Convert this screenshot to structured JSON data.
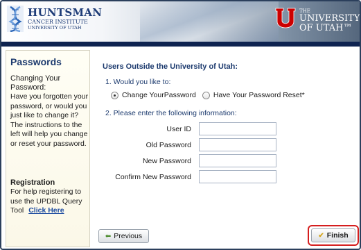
{
  "header": {
    "hci_logo": {
      "line1": "HUNTSMAN",
      "line2": "CANCER INSTITUTE",
      "line3": "UNIVERSITY OF UTAH"
    },
    "uu_logo": {
      "the": "THE",
      "line1": "UNIVERSITY",
      "line2": "OF UTAH™"
    },
    "colors": {
      "band": "#0e2350",
      "uu_red": "#cc0000",
      "hci_blue": "#1f3d78"
    }
  },
  "sidebar": {
    "title": "Passwords",
    "changing_heading": "Changing Your Password:",
    "changing_text": "Have you forgotten your password, or would you just like to change it? The instructions to the left will help you change or reset your password.",
    "registration_heading": "Registration",
    "registration_text": "For help registering to use the UPDBL Query Tool",
    "registration_link": "Click Here"
  },
  "main": {
    "section_title": "Users Outside the University of Utah:",
    "q1": "1. Would you like to:",
    "options": [
      {
        "label": "Change YourPassword",
        "checked": true
      },
      {
        "label": "Have Your Password Reset*",
        "checked": false
      }
    ],
    "q2": "2. Please enter the following information:",
    "fields": [
      {
        "label": "User ID",
        "value": ""
      },
      {
        "label": "Old Password",
        "value": ""
      },
      {
        "label": "New Password",
        "value": ""
      },
      {
        "label": "Confirm New Password",
        "value": ""
      }
    ]
  },
  "buttons": {
    "previous": {
      "label": "Previous",
      "icon": "arrow-left-icon"
    },
    "finish": {
      "label": "Finish",
      "icon": "checkmark-icon",
      "highlight_color": "#d51e1e"
    }
  }
}
